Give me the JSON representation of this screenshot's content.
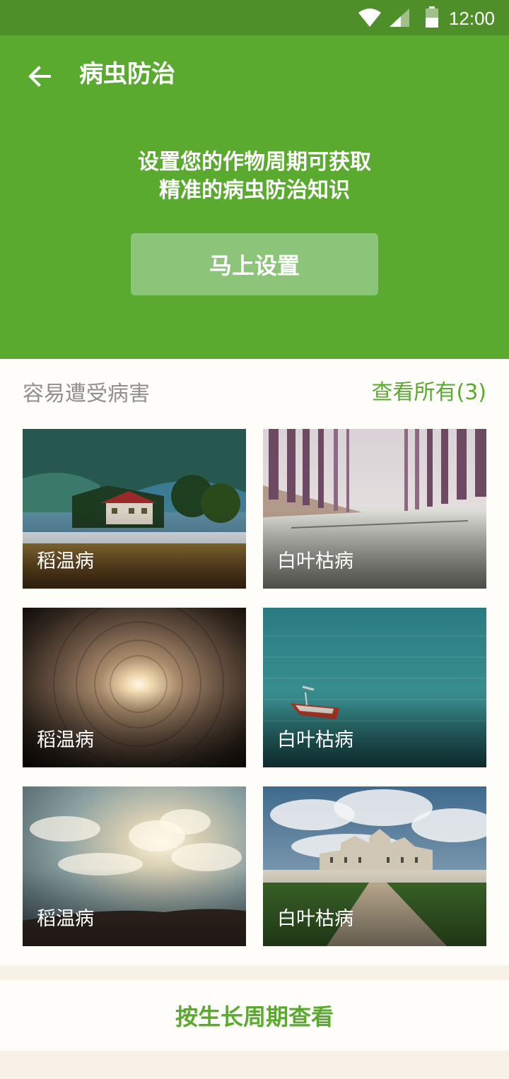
{
  "status_bar": {
    "time": "12:00"
  },
  "header": {
    "title": "病虫防治",
    "intro_line1": "设置您的作物周期可获取",
    "intro_line2": "精准的病虫防治知识",
    "setup_button": "马上设置"
  },
  "section": {
    "title": "容易遭受病害",
    "view_all": "查看所有(3)"
  },
  "cards": [
    {
      "label": "稻温病",
      "image": "mountain-lake-house-photo"
    },
    {
      "label": "白叶枯病",
      "image": "misty-tree-lined-road-photo"
    },
    {
      "label": "稻温病",
      "image": "tunnel-light-photo"
    },
    {
      "label": "白叶枯病",
      "image": "boat-on-teal-sea-photo"
    },
    {
      "label": "稻温病",
      "image": "sunlit-clouds-sky-photo"
    },
    {
      "label": "白叶枯病",
      "image": "chateau-under-clouds-photo"
    }
  ],
  "footer": {
    "button": "按生长周期查看"
  },
  "colors": {
    "primary": "#5aaa30",
    "status_bar": "#4e8f29",
    "button_light": "#8cc47a",
    "background": "#f7f1e7"
  }
}
